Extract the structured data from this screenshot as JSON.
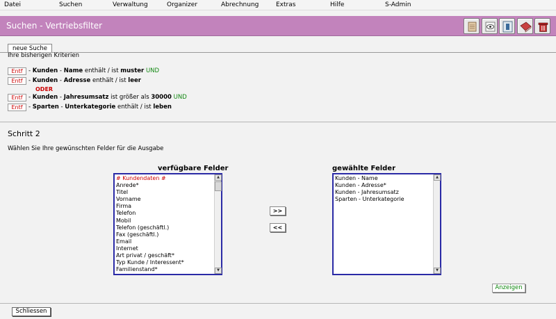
{
  "menu": [
    "Datei",
    "Suchen",
    "Verwaltung",
    "Organizer",
    "Abrechnung",
    "Extras",
    "Hilfe",
    "S-Admin"
  ],
  "header": {
    "title": "Suchen - Vertriebsfilter"
  },
  "tab": {
    "label": "neue Suche"
  },
  "criteria_heading": "Ihre bisherigen Kriterien",
  "remove_label": "Entf",
  "criteria": [
    {
      "category": "Kunden",
      "field": "Name",
      "operator": "enthält / ist",
      "value": "muster",
      "conjunction": "UND"
    },
    {
      "category": "Kunden",
      "field": "Adresse",
      "operator": "enthält / ist",
      "value": "leer",
      "conjunction": ""
    },
    {
      "category": "Kunden",
      "field": "Jahresumsatz",
      "operator": "ist größer als",
      "value": "30000",
      "conjunction": "UND"
    },
    {
      "category": "Sparten",
      "field": "Unterkategorie",
      "operator": "enthält / ist",
      "value": "leben",
      "conjunction": ""
    }
  ],
  "or_label": "ODER",
  "step": {
    "title": "Schritt 2",
    "hint": "Wählen Sie Ihre gewünschten Felder für die Ausgabe"
  },
  "available_label": "verfügbare Felder",
  "selected_label": "gewählte Felder",
  "available_fields": [
    "# Kundendaten #",
    "Anrede*",
    "Titel",
    "Vorname",
    "Firma",
    "Telefon",
    "Mobil",
    "Telefon (geschäftl.)",
    "Fax (geschäftl.)",
    "Email",
    "Internet",
    "Art privat / geschäft*",
    "Typ Kunde / Interessent*",
    "Familienstand*"
  ],
  "selected_fields": [
    "Kunden - Name",
    "Kunden - Adresse*",
    "Kunden - Jahresumsatz",
    "Sparten - Unterkategorie"
  ],
  "buttons": {
    "add": ">>",
    "remove": "<<",
    "show": "Anzeigen",
    "close": "Schliessen"
  },
  "colors": {
    "titlebar": "#c283bc",
    "list_border": "#2a2aa6",
    "remove_text": "#cc0000",
    "conjunction": "#118811"
  }
}
